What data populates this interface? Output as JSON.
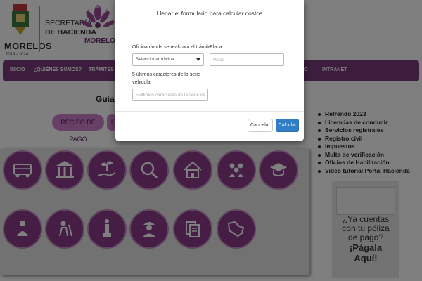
{
  "header": {
    "state_name": "MORELOS",
    "state_years": "2019 - 2024",
    "secretaria_line1": "SECRETARÍA",
    "secretaria_line2": "DE HACIENDA",
    "brand_name": "MORELOS"
  },
  "nav": {
    "items": [
      {
        "label": "INICIO"
      },
      {
        "label": "¿QUIÉNES SOMOS?"
      },
      {
        "label": "TRÁMITES Y S"
      },
      {
        "label": "O"
      },
      {
        "label": "INTRANET"
      }
    ]
  },
  "main": {
    "guide_link": "Guía rá",
    "pills": [
      {
        "label": "RECIBO DE PAGO"
      },
      {
        "label": "I"
      }
    ],
    "circles": [
      {
        "icon": "bus-icon"
      },
      {
        "icon": "government-building-icon"
      },
      {
        "icon": "hand-plant-icon"
      },
      {
        "icon": "magnifier-icon"
      },
      {
        "icon": "house-icon"
      },
      {
        "icon": "people-group-icon"
      },
      {
        "icon": "graduation-cap-icon"
      },
      {
        "icon": "person-icon"
      },
      {
        "icon": "farmer-icon"
      },
      {
        "icon": "statue-icon"
      },
      {
        "icon": "worker-icon"
      },
      {
        "icon": "documents-icon"
      },
      {
        "icon": "map-icon"
      }
    ]
  },
  "sidebar": {
    "links": [
      "Refrendo 2023",
      "Licencias de conducir",
      "Servicios registrales",
      "Registro civil",
      "Impuestos",
      "Multa de verificación",
      "Oficios de Habilitación",
      "Video tutorial Portal Hacienda"
    ],
    "ad": {
      "line1": "¿Ya cuentas",
      "line2": "con tu póliza",
      "line3": "de pago?",
      "line4": "¡Págala",
      "line5": "Aquí!"
    }
  },
  "modal": {
    "title": "Llenar el formulario para calcular costos",
    "office_label": "Oficina donde se realizará el trámite",
    "office_value": "Seleccionar oficina",
    "plate_label": "Placa",
    "plate_placeholder": "Placa",
    "serie_label_line1": "5 últimos caracteres de la serie",
    "serie_label_line2": "vehicular",
    "serie_placeholder": "5 últimos caracteres de la serie vehicu",
    "cancel_label": "Cancelar",
    "calc_label": "Calcular"
  },
  "colors": {
    "brand_purple": "#7b3b7b",
    "pill_pink": "#cf7fcf",
    "circle_purple": "#8a3a8a",
    "primary_button": "#2f7ec6"
  }
}
